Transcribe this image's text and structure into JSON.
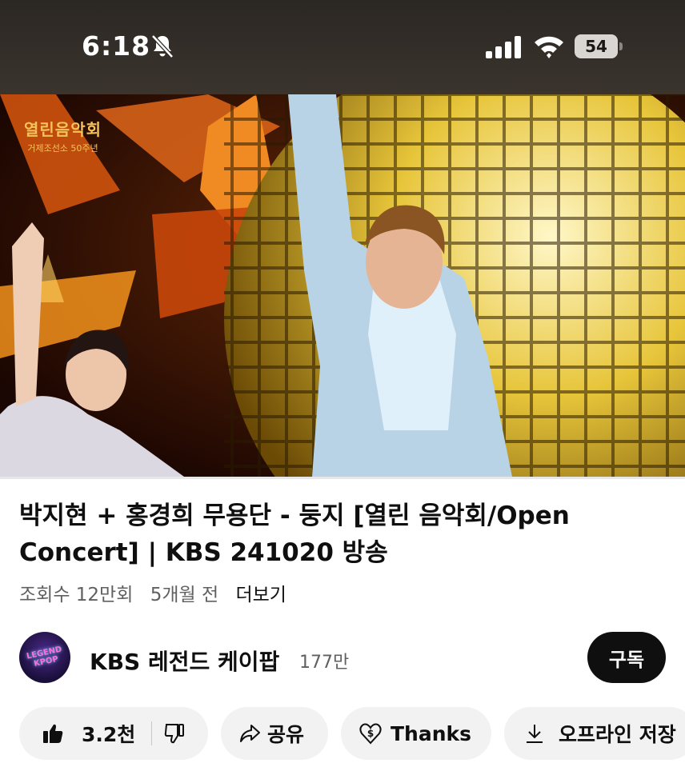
{
  "status_bar": {
    "time": "6:18",
    "battery": "54"
  },
  "video": {
    "watermark_title": "열린음악회",
    "watermark_subtitle": "거제조선소 50주년",
    "progress_fraction": 0.0
  },
  "title": "박지현 + 홍경희 무용단 - 둥지 [열린 음악회/Open Concert] | KBS 241020 방송",
  "meta": {
    "views": "조회수 12만회",
    "age": "5개월 전",
    "more": "더보기"
  },
  "channel": {
    "avatar_text_top": "LEGEND",
    "avatar_text_bottom": "KPOP",
    "name": "KBS 레전드 케이팝",
    "subscribers": "177만",
    "subscribe_label": "구독"
  },
  "actions": {
    "like_count": "3.2천",
    "share": "공유",
    "thanks": "Thanks",
    "offline": "오프라인 저장"
  },
  "colors": {
    "accent": "#ff0000",
    "chip_bg": "#f2f2f2",
    "subscribe_bg": "#0f0f0f"
  },
  "icons": [
    "bell-slash-icon",
    "signal-icon",
    "wifi-icon",
    "battery-icon",
    "thumbs-up-icon",
    "thumbs-down-icon",
    "share-icon",
    "thanks-icon",
    "download-icon"
  ]
}
